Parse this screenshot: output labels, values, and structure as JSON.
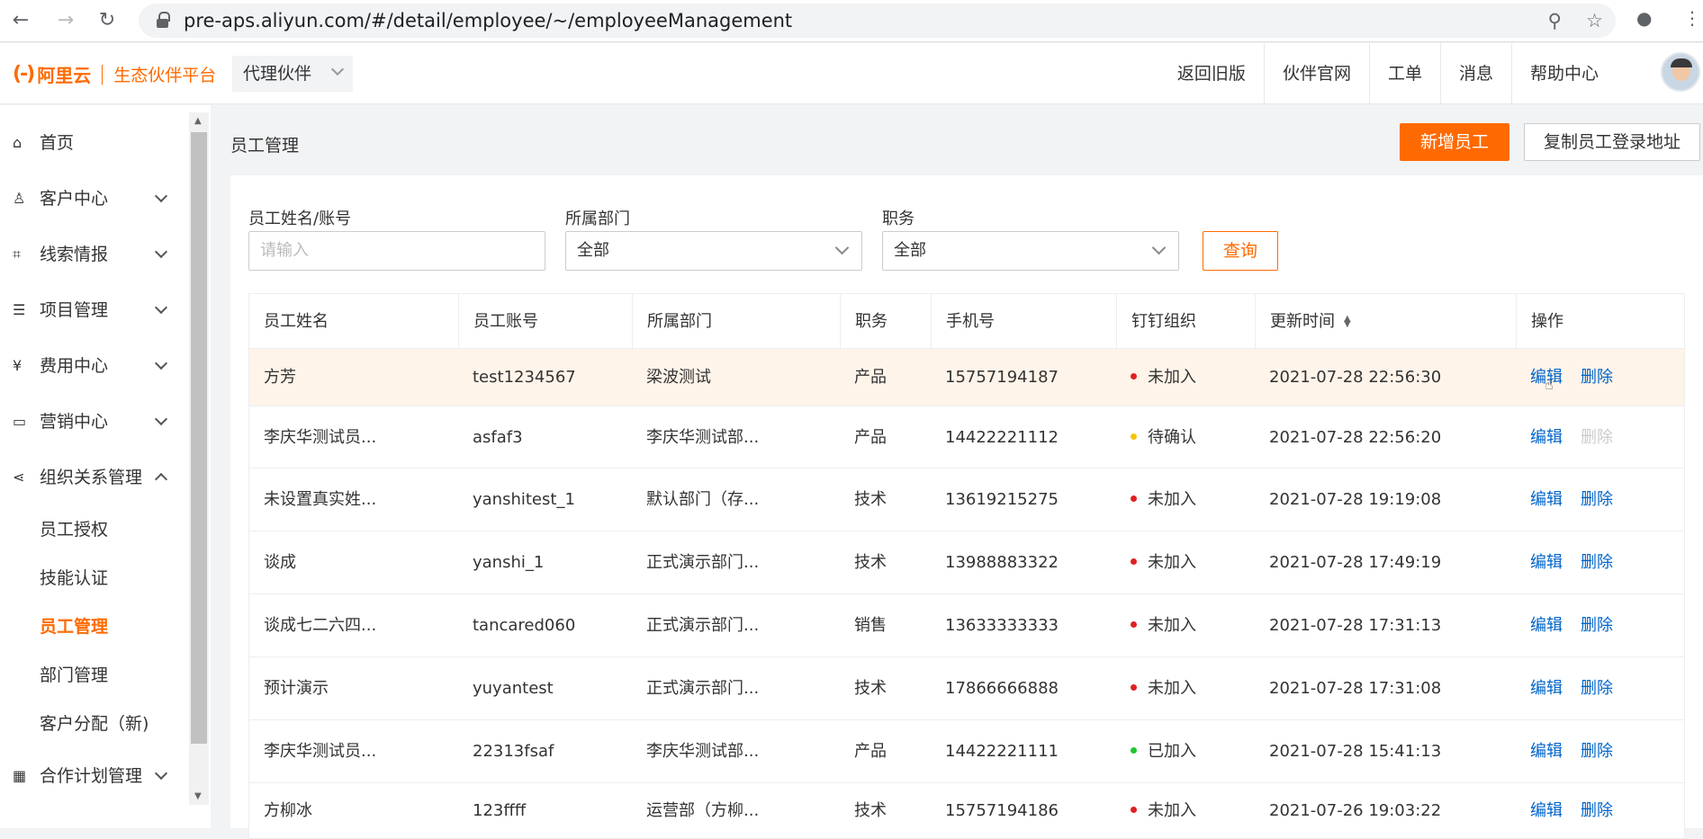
{
  "browser": {
    "back_icon": "arrow-left-icon",
    "forward_icon": "arrow-right-icon",
    "reload_icon": "reload-icon",
    "url": "pre-aps.aliyun.com/#/detail/employee/~/employeeManagement"
  },
  "header": {
    "logo_brand": "阿里云",
    "logo_platform": "生态伙伴平台",
    "partner_select": "代理伙伴",
    "links": [
      "返回旧版",
      "伙伴官网",
      "工单",
      "消息",
      "帮助中心"
    ]
  },
  "sidebar": {
    "items": [
      {
        "label": "首页",
        "icon": "home-icon",
        "expandable": false
      },
      {
        "label": "客户中心",
        "icon": "user-icon",
        "expandable": true
      },
      {
        "label": "线索情报",
        "icon": "nodes-icon",
        "expandable": true
      },
      {
        "label": "项目管理",
        "icon": "list-icon",
        "expandable": true
      },
      {
        "label": "费用中心",
        "icon": "yen-icon",
        "expandable": true
      },
      {
        "label": "营销中心",
        "icon": "bag-icon",
        "expandable": true
      },
      {
        "label": "组织关系管理",
        "icon": "share-icon",
        "expandable": true
      }
    ],
    "sub_items": [
      "员工授权",
      "技能认证",
      "员工管理",
      "部门管理",
      "客户分配（新)"
    ],
    "active_sub": "员工管理",
    "bottom_item": {
      "label": "合作计划管理",
      "icon": "calendar-icon"
    }
  },
  "page": {
    "title": "员工管理",
    "add_button": "新增员工",
    "copy_button": "复制员工登录地址"
  },
  "filters": {
    "name_label": "员工姓名/账号",
    "name_placeholder": "请输入",
    "dept_label": "所属部门",
    "dept_value": "全部",
    "role_label": "职务",
    "role_value": "全部",
    "query_button": "查询"
  },
  "table": {
    "columns": [
      "员工姓名",
      "员工账号",
      "所属部门",
      "职务",
      "手机号",
      "钉钉组织",
      "更新时间",
      "操作"
    ],
    "edit_label": "编辑",
    "delete_label": "删除",
    "status_colors": {
      "未加入": "#e02020",
      "待确认": "#f5c400",
      "已加入": "#1ec82c"
    },
    "rows": [
      {
        "name": "方芳",
        "account": "test1234567",
        "dept": "梁波测试",
        "role": "产品",
        "phone": "15757194187",
        "status": "未加入",
        "updated": "2021-07-28 22:56:30",
        "delete_disabled": false
      },
      {
        "name": "李庆华测试员...",
        "account": "asfaf3",
        "dept": "李庆华测试部...",
        "role": "产品",
        "phone": "14422221112",
        "status": "待确认",
        "updated": "2021-07-28 22:56:20",
        "delete_disabled": true
      },
      {
        "name": "未设置真实姓...",
        "account": "yanshitest_1",
        "dept": "默认部门（存...",
        "role": "技术",
        "phone": "13619215275",
        "status": "未加入",
        "updated": "2021-07-28 19:19:08",
        "delete_disabled": false
      },
      {
        "name": "谈成",
        "account": "yanshi_1",
        "dept": "正式演示部门...",
        "role": "技术",
        "phone": "13988883322",
        "status": "未加入",
        "updated": "2021-07-28 17:49:19",
        "delete_disabled": false
      },
      {
        "name": "谈成七二六四...",
        "account": "tancared060",
        "dept": "正式演示部门...",
        "role": "销售",
        "phone": "13633333333",
        "status": "未加入",
        "updated": "2021-07-28 17:31:13",
        "delete_disabled": false
      },
      {
        "name": "预计演示",
        "account": "yuyantest",
        "dept": "正式演示部门...",
        "role": "技术",
        "phone": "17866666888",
        "status": "未加入",
        "updated": "2021-07-28 17:31:08",
        "delete_disabled": false
      },
      {
        "name": "李庆华测试员...",
        "account": "22313fsaf",
        "dept": "李庆华测试部...",
        "role": "产品",
        "phone": "14422221111",
        "status": "已加入",
        "updated": "2021-07-28 15:41:13",
        "delete_disabled": false
      },
      {
        "name": "方柳冰",
        "account": "123ffff",
        "dept": "运营部（方柳...",
        "role": "技术",
        "phone": "15757194186",
        "status": "未加入",
        "updated": "2021-07-26 19:03:22",
        "delete_disabled": false
      }
    ]
  }
}
